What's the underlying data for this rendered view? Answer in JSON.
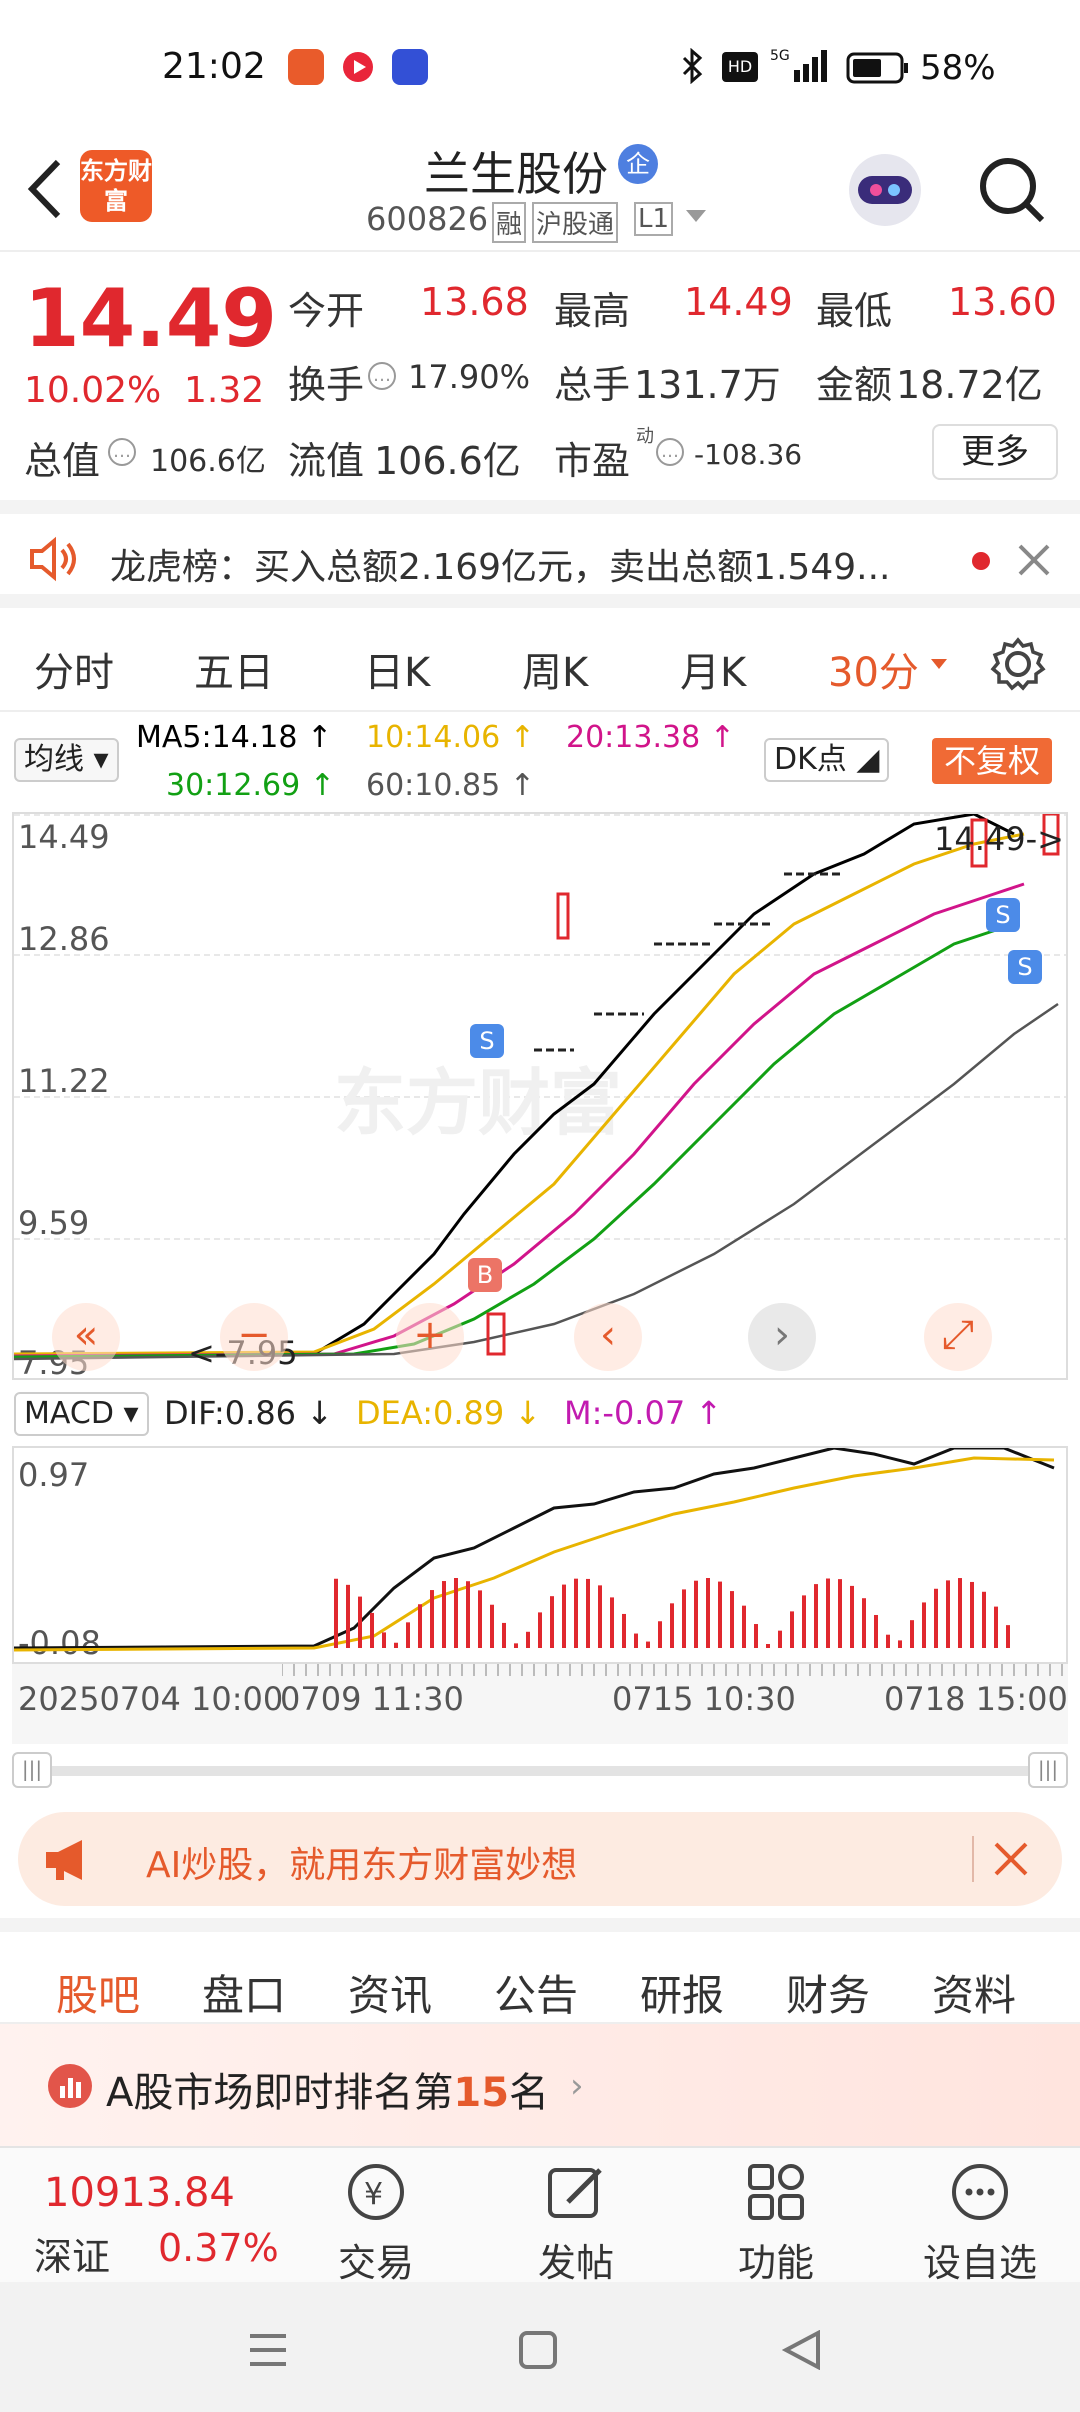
{
  "status": {
    "time": "21:02",
    "battery": "58%",
    "net": "5G"
  },
  "header": {
    "logo_text": "东方财富",
    "title": "兰生股份",
    "title_badge": "企",
    "code": "600826",
    "tags": [
      "融",
      "沪股通",
      "L1"
    ]
  },
  "quote": {
    "price": "14.49",
    "pct": "10.02%",
    "chg": "1.32",
    "open_label": "今开",
    "open": "13.68",
    "high_label": "最高",
    "high": "14.49",
    "low_label": "最低",
    "low": "13.60",
    "turnover_label": "换手",
    "turnover": "17.90%",
    "volume_label": "总手",
    "volume": "131.7万",
    "amount_label": "金额",
    "amount": "18.72亿",
    "mcap_label": "总值",
    "mcap": "106.6亿",
    "float_label": "流值",
    "float_val": "106.6亿",
    "pe_label": "市盈",
    "pe_sup": "动",
    "pe": "-108.36",
    "more_btn": "更多"
  },
  "notice": {
    "text": "龙虎榜：买入总额2.169亿元，卖出总额1.549..."
  },
  "periods": [
    "分时",
    "五日",
    "日K",
    "周K",
    "月K",
    "30分"
  ],
  "ma": {
    "selector": "均线",
    "ma5": "MA5:14.18",
    "ma10": "10:14.06",
    "ma20": "20:13.38",
    "ma30": "30:12.69",
    "ma60": "60:10.85",
    "dk": "DK点",
    "adjust": "不复权"
  },
  "chart": {
    "y_labels": [
      "14.49",
      "12.86",
      "11.22",
      "9.59",
      "7.95"
    ],
    "low_marker": "<-7.95",
    "high_marker": "14.49->",
    "watermark": "东方财富",
    "buy_marker": "B",
    "sell_marker": "S"
  },
  "macd": {
    "selector": "MACD",
    "dif": "DIF:0.86",
    "dea": "DEA:0.89",
    "m": "M:-0.07",
    "y_top": "0.97",
    "y_bot": "-0.08"
  },
  "time_axis": [
    "20250704 10:00",
    "0709 11:30",
    "0715 10:30",
    "0718 15:00"
  ],
  "ai_banner": {
    "text": "AI炒股，就用东方财富妙想"
  },
  "tabs2": [
    "股吧",
    "盘口",
    "资讯",
    "公告",
    "研报",
    "财务",
    "资料"
  ],
  "rank": {
    "prefix": "A股市场即时排名第",
    "num": "15",
    "suffix": "名"
  },
  "bottom": {
    "index_val": "10913.84",
    "index_name": "深证",
    "index_pct": "0.37%",
    "items": [
      "交易",
      "发帖",
      "功能",
      "设自选"
    ]
  },
  "colors": {
    "accent": "#e55a2c",
    "up": "#e0282e",
    "down": "#1a9a35",
    "ma5": "#000000",
    "ma10": "#e8b400",
    "ma20": "#d1148a",
    "ma30": "#12a014",
    "ma60": "#555555"
  }
}
